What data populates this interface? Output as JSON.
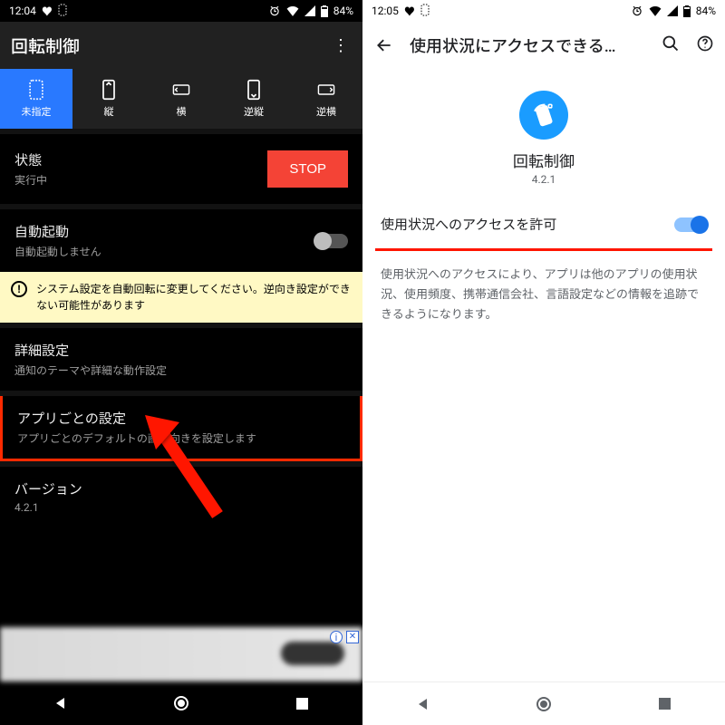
{
  "left": {
    "status": {
      "time": "12:04",
      "battery": "84%"
    },
    "appbar": {
      "title": "回転制御"
    },
    "tabs": [
      {
        "label": "未指定",
        "selected": true
      },
      {
        "label": "縦"
      },
      {
        "label": "横"
      },
      {
        "label": "逆縦"
      },
      {
        "label": "逆横"
      }
    ],
    "state": {
      "title": "状態",
      "subtitle": "実行中",
      "button": "STOP"
    },
    "autostart": {
      "title": "自動起動",
      "subtitle": "自動起動しません",
      "on": false
    },
    "warning": "システム設定を自動回転に変更してください。逆向き設定ができない可能性があります",
    "detail": {
      "title": "詳細設定",
      "subtitle": "通知のテーマや詳細な動作設定"
    },
    "perapp": {
      "title": "アプリごとの設定",
      "subtitle": "アプリごとのデフォルトの画面向きを設定します"
    },
    "version": {
      "title": "バージョン",
      "subtitle": "4.2.1"
    }
  },
  "right": {
    "status": {
      "time": "12:05",
      "battery": "84%"
    },
    "appbar": {
      "title": "使用状況にアクセスできる…"
    },
    "app": {
      "name": "回転制御",
      "version": "4.2.1"
    },
    "permission": {
      "label": "使用状況へのアクセスを許可",
      "on": true
    },
    "description": "使用状況へのアクセスにより、アプリは他のアプリの使用状況、使用頻度、携帯通信会社、言語設定などの情報を追跡できるようになります。"
  }
}
